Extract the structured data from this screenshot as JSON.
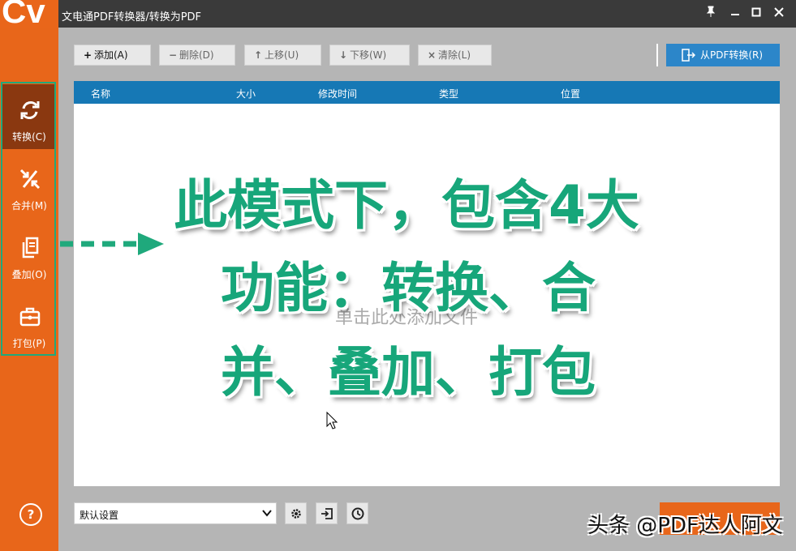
{
  "app": {
    "title": "文电通PDF转换器/转换为PDF",
    "logo_text": "Cv"
  },
  "window_controls": [
    "pin-icon",
    "minimize-icon",
    "maximize-icon",
    "close-icon"
  ],
  "sidebar": {
    "items": [
      {
        "label": "转换(C)",
        "icon": "convert-icon",
        "active": true
      },
      {
        "label": "合并(M)",
        "icon": "merge-icon",
        "active": false
      },
      {
        "label": "叠加(O)",
        "icon": "overlay-icon",
        "active": false
      },
      {
        "label": "打包(P)",
        "icon": "package-icon",
        "active": false
      }
    ],
    "help_label": "?"
  },
  "toolbar": {
    "add": {
      "label": "添加(A)",
      "icon": "plus-icon"
    },
    "delete": {
      "label": "删除(D)",
      "icon": "minus-icon"
    },
    "move_up": {
      "label": "上移(U)",
      "icon": "arrow-up-icon"
    },
    "move_down": {
      "label": "下移(W)",
      "icon": "arrow-down-icon"
    },
    "clear": {
      "label": "清除(L)",
      "icon": "x-icon"
    },
    "from_pdf": {
      "label": "从PDF转换(R)",
      "icon": "export-icon"
    }
  },
  "file_list": {
    "columns": [
      "名称",
      "大小",
      "修改时间",
      "类型",
      "位置"
    ],
    "empty_hint": "单击此处添加文件"
  },
  "overlay": {
    "lines": [
      "此模式下，包含4大",
      "功能：转换、合",
      "并、叠加、打包"
    ],
    "color": "#17a67a"
  },
  "bottom": {
    "preset_value": "默认设置",
    "buttons": [
      "settings-gear-icon",
      "import-icon",
      "clock-icon"
    ]
  },
  "watermark": "头条 @PDF达人阿文",
  "colors": {
    "accent": "#e8661a",
    "header_blue": "#1678b5",
    "button_blue": "#2c86c9",
    "highlight_green": "#1fa97c"
  }
}
